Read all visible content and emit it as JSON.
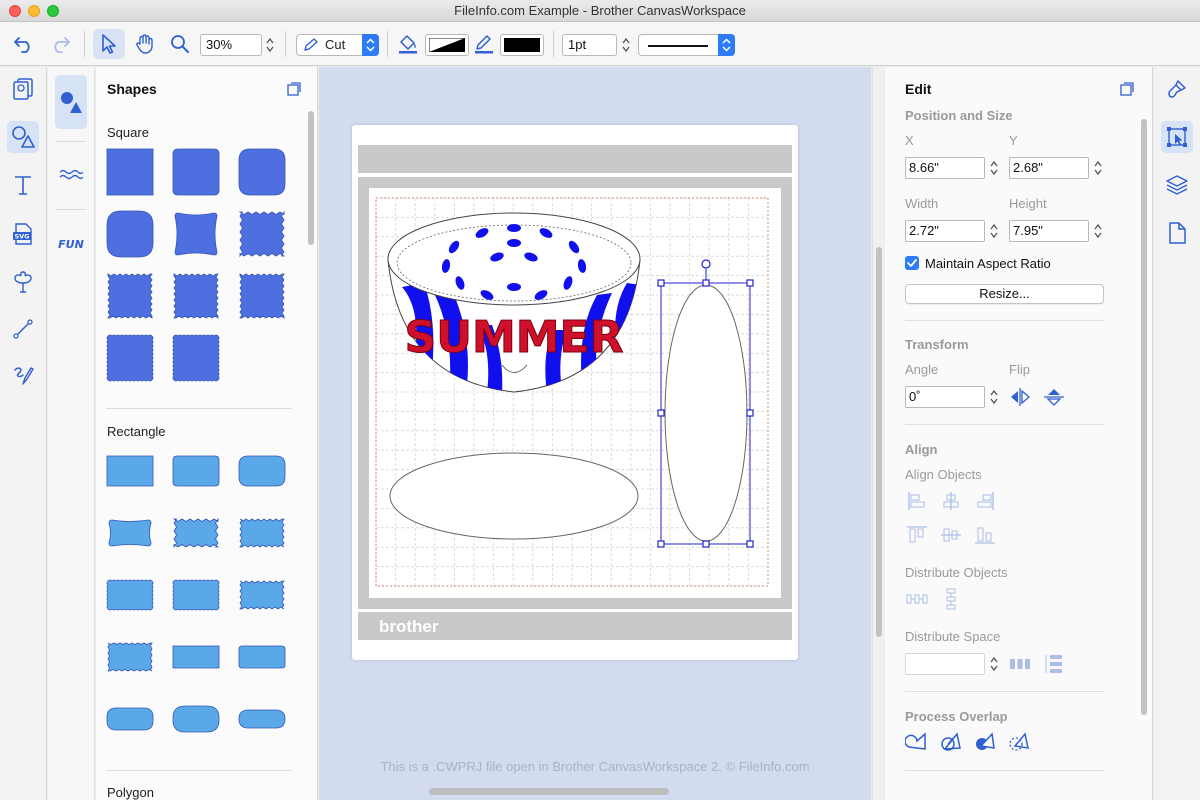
{
  "window": {
    "title": "FileInfo.com Example - Brother CanvasWorkspace"
  },
  "toolbar": {
    "zoom_value": "30%",
    "mode_value": "Cut",
    "line_width_value": "1pt",
    "fill_color": "#000000",
    "line_color": "#000000"
  },
  "shapes_panel": {
    "title": "Shapes",
    "sections": {
      "square": "Square",
      "rectangle": "Rectangle",
      "polygon": "Polygon"
    },
    "square_color": "#4f6fe0",
    "rectangle_color": "#5aa8e8"
  },
  "canvas": {
    "summer_text": "SUMMER",
    "brand_text": "brother",
    "caption": "This is a .CWPRJ file open in Brother CanvasWorkspace 2. © FileInfo.com",
    "background": "#d2dbef"
  },
  "edit_panel": {
    "title": "Edit",
    "position_size": {
      "heading": "Position and Size",
      "x_label": "X",
      "y_label": "Y",
      "x_value": "8.66\"",
      "y_value": "2.68\"",
      "width_label": "Width",
      "height_label": "Height",
      "width_value": "2.72\"",
      "height_value": "7.95\"",
      "maintain_aspect_label": "Maintain Aspect Ratio",
      "maintain_aspect_checked": true,
      "resize_button": "Resize..."
    },
    "transform": {
      "heading": "Transform",
      "angle_label": "Angle",
      "flip_label": "Flip",
      "angle_value": "0˚"
    },
    "align": {
      "heading": "Align",
      "align_objects_label": "Align Objects",
      "distribute_objects_label": "Distribute Objects",
      "distribute_space_label": "Distribute Space",
      "distribute_space_value": ""
    },
    "process_overlap": {
      "heading": "Process Overlap"
    }
  },
  "accent_color": "#2d7cf6",
  "icon_color": "#2f5fd0"
}
